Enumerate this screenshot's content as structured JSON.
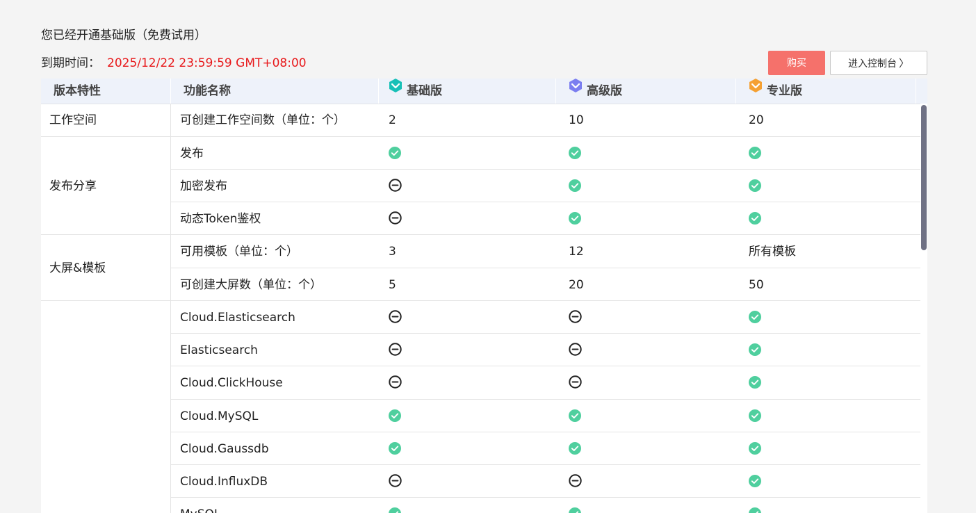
{
  "header": {
    "title": "您已经开通基础版（免费试用）",
    "expiry_label": "到期时间：",
    "expiry_value": "2025/12/22 23:59:59 GMT+08:00",
    "buy_label": "购买",
    "console_label": "进入控制台"
  },
  "table": {
    "columns": [
      "版本特性",
      "功能名称",
      "基础版",
      "高级版",
      "专业版"
    ],
    "groups": [
      {
        "category": "工作空间"
      },
      {
        "category": "发布分享"
      },
      {
        "category": "大屏&模板"
      },
      {
        "category": ""
      }
    ],
    "rows": [
      {
        "feature": "可创建工作空间数（单位：个）",
        "basic": "2",
        "advanced": "10",
        "pro": "20"
      },
      {
        "feature": "发布",
        "basic": "check",
        "advanced": "check",
        "pro": "check"
      },
      {
        "feature": "加密发布",
        "basic": "none",
        "advanced": "check",
        "pro": "check"
      },
      {
        "feature": "动态Token鉴权",
        "basic": "none",
        "advanced": "check",
        "pro": "check"
      },
      {
        "feature": "可用模板（单位：个）",
        "basic": "3",
        "advanced": "12",
        "pro": "所有模板"
      },
      {
        "feature": "可创建大屏数（单位：个）",
        "basic": "5",
        "advanced": "20",
        "pro": "50"
      },
      {
        "feature": "Cloud.Elasticsearch",
        "basic": "none",
        "advanced": "none",
        "pro": "check"
      },
      {
        "feature": "Elasticsearch",
        "basic": "none",
        "advanced": "none",
        "pro": "check"
      },
      {
        "feature": "Cloud.ClickHouse",
        "basic": "none",
        "advanced": "none",
        "pro": "check"
      },
      {
        "feature": "Cloud.MySQL",
        "basic": "check",
        "advanced": "check",
        "pro": "check"
      },
      {
        "feature": "Cloud.Gaussdb",
        "basic": "check",
        "advanced": "check",
        "pro": "check"
      },
      {
        "feature": "Cloud.InfluxDB",
        "basic": "none",
        "advanced": "none",
        "pro": "check"
      },
      {
        "feature": "MySQL",
        "basic": "check",
        "advanced": "check",
        "pro": "check"
      }
    ]
  },
  "icons": {
    "basic_plan": "teal-diamond-icon",
    "advanced_plan": "purple-diamond-icon",
    "pro_plan": "orange-diamond-icon",
    "supported": "check-circle-icon",
    "unsupported": "minus-circle-icon"
  },
  "colors": {
    "buy_button": "#f5716b",
    "expiry_value": "#e8191b",
    "check": "#4fcf9e",
    "header_bg": "#eef2fa",
    "basic_plan": "#17c0b7",
    "advanced_plan": "#7b7ef0",
    "pro_plan": "#f5a032"
  }
}
